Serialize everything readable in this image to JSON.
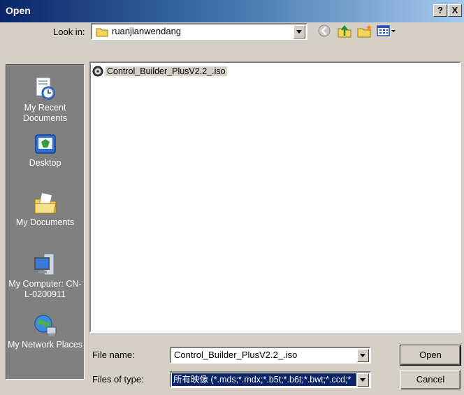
{
  "window": {
    "title": "Open",
    "help_label": "?",
    "close_label": "X"
  },
  "lookin": {
    "label": "Look in:",
    "value": "ruanjianwendang"
  },
  "places": {
    "items": [
      {
        "label": "My Recent Documents"
      },
      {
        "label": "Desktop"
      },
      {
        "label": "My Documents"
      },
      {
        "label": "My Computer: CN-L-0200911"
      },
      {
        "label": "My Network Places"
      }
    ]
  },
  "files": {
    "items": [
      {
        "name": "Control_Builder_PlusV2.2_.iso"
      }
    ]
  },
  "filename": {
    "label": "File name:",
    "value": "Control_Builder_PlusV2.2_.iso"
  },
  "filetype": {
    "label": "Files of type:",
    "value": "所有映像 (*.mds;*.mdx;*.b5t;*.b6t;*.bwt;*.ccd;*"
  },
  "buttons": {
    "open": "Open",
    "cancel": "Cancel"
  }
}
